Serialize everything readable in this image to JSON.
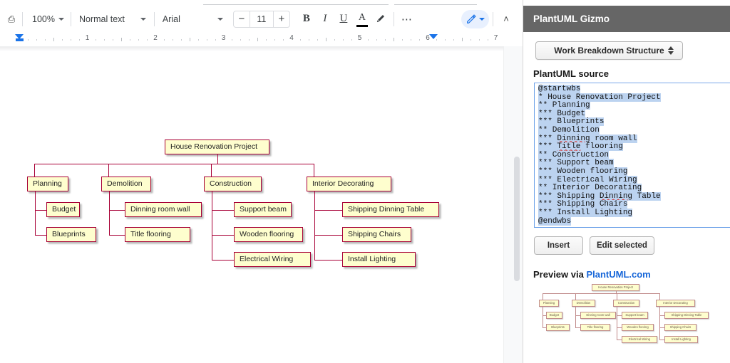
{
  "docs": {
    "toolbar": {
      "zoom": "100%",
      "paragraph_style": "Normal text",
      "font_family": "Arial",
      "font_size": "11",
      "decrease_label": "−",
      "increase_label": "+",
      "bold_label": "B",
      "italic_label": "I",
      "underline_label": "U",
      "text_color_label": "A",
      "more_label": "⋯",
      "collapse_label": "˄"
    },
    "ruler": {
      "numbers": [
        "1",
        "2",
        "3",
        "4",
        "5",
        "6",
        "7"
      ]
    },
    "diagram": {
      "root": "House Renovation Project",
      "branches": [
        {
          "title": "Planning",
          "children": [
            "Budget",
            "Blueprints"
          ]
        },
        {
          "title": "Demolition",
          "children": [
            "Dinning room wall",
            "Title flooring"
          ]
        },
        {
          "title": "Construction",
          "children": [
            "Support beam",
            "Wooden flooring",
            "Electrical Wiring"
          ]
        },
        {
          "title": "Interior Decorating",
          "children": [
            "Shipping Dinning Table",
            "Shipping Chairs",
            "Install Lighting"
          ]
        }
      ],
      "colors": {
        "fill": "#FEFECE",
        "border": "#A80036",
        "text": "#222222"
      }
    }
  },
  "sidebar": {
    "title": "PlantUML Gizmo",
    "diagram_type": "Work Breakdown Structure",
    "source_label": "PlantUML source",
    "source_lines": [
      "@startwbs",
      "* House Renovation Project",
      "** Planning",
      "*** Budget",
      "*** Blueprints",
      "** Demolition",
      "*** Dinning room wall",
      "*** Title flooring",
      "** Construction",
      "*** Support beam",
      "*** Wooden flooring",
      "*** Electrical Wiring",
      "** Interior Decorating",
      "*** Shipping Dinning Table",
      "*** Shipping Chairs",
      "*** Install Lighting",
      "@endwbs"
    ],
    "insert_label": "Insert",
    "edit_label": "Edit selected",
    "preview_label": "Preview via ",
    "preview_link": "PlantUML.com",
    "header_bg": "#666666",
    "link_color": "#1565d8"
  }
}
